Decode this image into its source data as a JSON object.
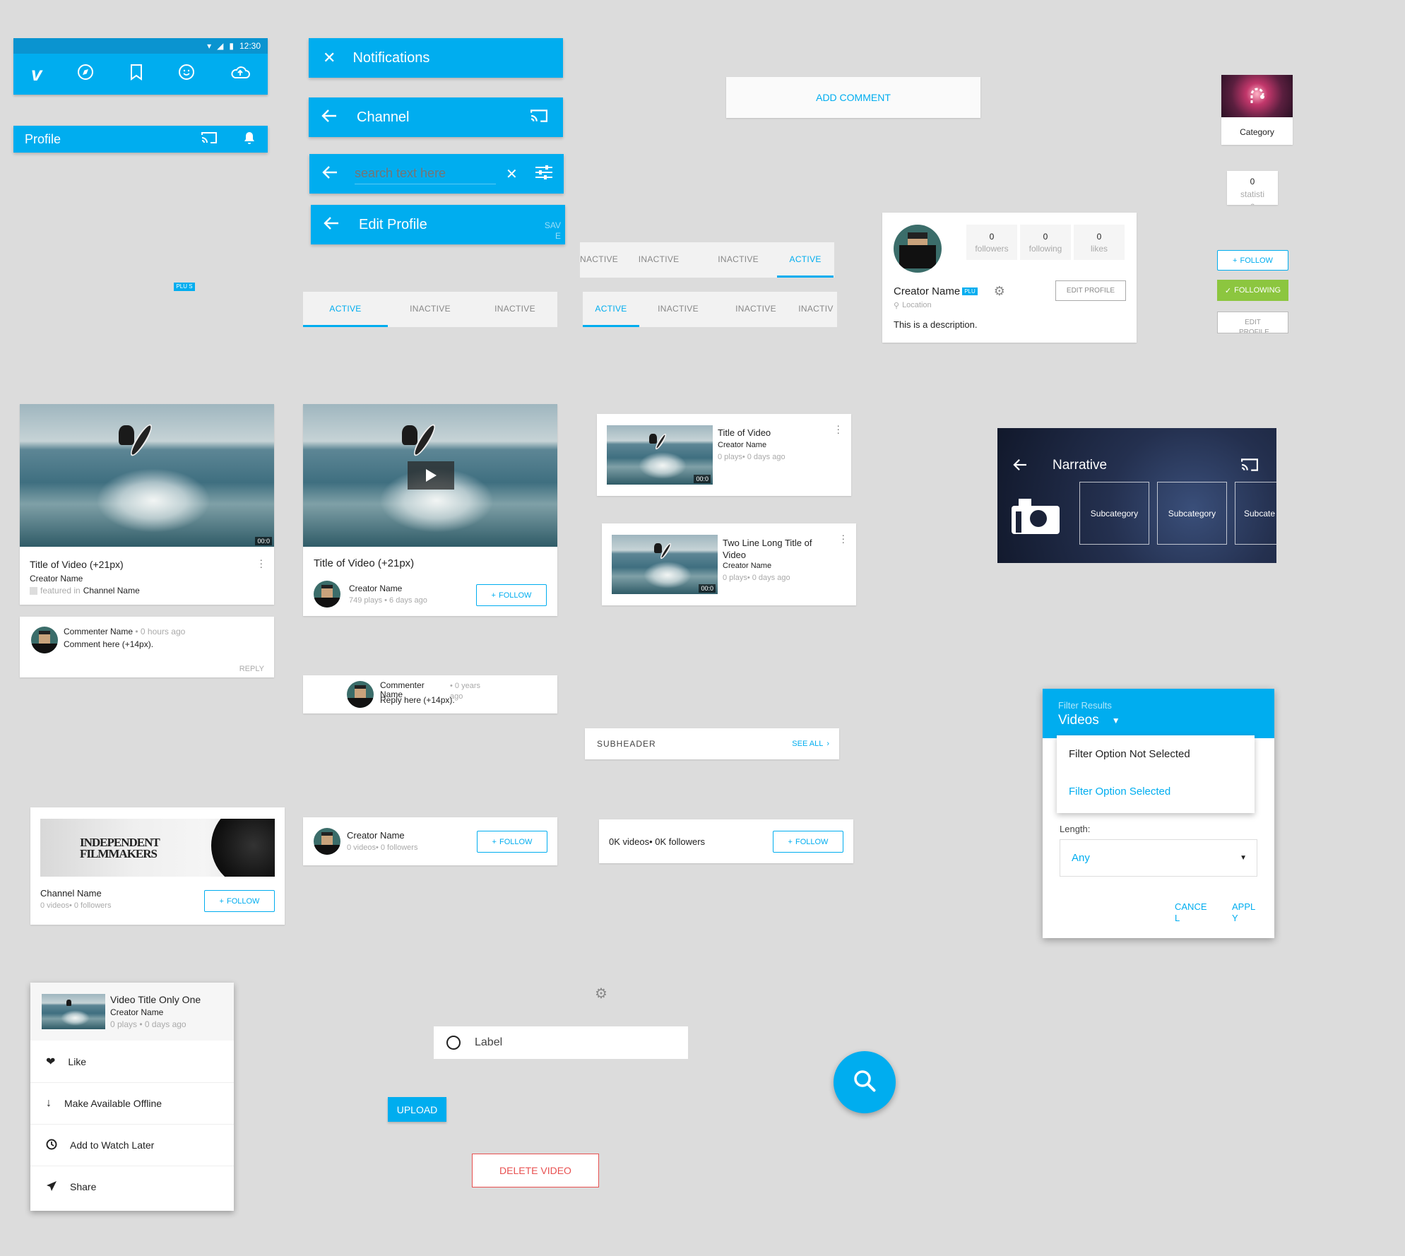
{
  "status_bar": {
    "time": "12:30"
  },
  "top_nav": {
    "icons": [
      "vimeo-logo-icon",
      "compass-icon",
      "bookmark-icon",
      "smiley-icon",
      "cloud-upload-icon"
    ]
  },
  "profile_bar": {
    "title": "Profile"
  },
  "appbars": {
    "notifications": "Notifications",
    "channel": "Channel",
    "search_placeholder": "search text here",
    "edit_profile": "Edit Profile",
    "save": "SAV E"
  },
  "plus_badge": "PLU S",
  "tabs_a": [
    "ACTIVE",
    "INACTIVE",
    "INACTIVE"
  ],
  "tabs_b": [
    "ACTIVE",
    "INACTIVE",
    "INACTIVE",
    "INACTIV"
  ],
  "tabs_c": [
    "NACTIVE",
    "INACTIVE",
    "INACTIVE",
    "ACTIVE"
  ],
  "add_comment": "ADD COMMENT",
  "category_tile": {
    "label": "Category"
  },
  "stat_tile": {
    "value": "0",
    "label": "statisti c"
  },
  "profile_card": {
    "stats": [
      {
        "value": "0",
        "label": "followers"
      },
      {
        "value": "0",
        "label": "following"
      },
      {
        "value": "0",
        "label": "likes"
      }
    ],
    "name": "Creator Name",
    "badge": "PLU",
    "location": "Location",
    "description": "This is a description.",
    "edit_button": "EDIT PROFILE"
  },
  "follow_buttons": {
    "follow": "FOLLOW",
    "following": "FOLLOWING",
    "edit_profile": "EDIT PROFILE"
  },
  "video_card_1": {
    "title": "Title of Video (+21px)",
    "creator": "Creator Name",
    "featured_prefix": "featured in",
    "channel": "Channel Name",
    "duration": "00:0"
  },
  "video_card_2": {
    "title": "Title of Video (+21px)",
    "creator": "Creator Name",
    "meta": "749 plays • 6 days ago",
    "follow": "FOLLOW"
  },
  "list_video_1": {
    "title": "Title of Video",
    "creator": "Creator Name",
    "meta": "0 plays• 0 days ago",
    "duration": "00:0"
  },
  "list_video_2": {
    "title": "Two Line Long Title of Video",
    "creator": "Creator Name",
    "meta": "0 plays• 0 days ago",
    "duration": "00:0"
  },
  "comment": {
    "name": "Commenter Name",
    "time": "• 0 hours ago",
    "text": "Comment here (+14px).",
    "reply": "REPLY"
  },
  "reply": {
    "name": "Commenter Name",
    "time": "• 0 years ago",
    "text": "Reply here (+14px)."
  },
  "subheader": {
    "label": "SUBHEADER",
    "see_all": "SEE ALL"
  },
  "category_header": {
    "title": "Narrative",
    "subcategories": [
      "Subcategory",
      "Subcategory",
      "Subcate"
    ]
  },
  "channel_card": {
    "banner_text": "INDEPENDENT FILMMAKERS",
    "name": "Channel Name",
    "meta": "0 videos• 0 followers",
    "follow": "FOLLOW"
  },
  "creator_row": {
    "name": "Creator Name",
    "meta": "0 videos• 0 followers",
    "follow": "FOLLOW"
  },
  "stats_row": {
    "text": "0K videos• 0K followers",
    "follow": "FOLLOW"
  },
  "filter_dialog": {
    "header_label": "Filter Results",
    "header_value": "Videos",
    "options": [
      {
        "label": "Filter Option Not Selected",
        "selected": false
      },
      {
        "label": "Filter Option Selected",
        "selected": true
      }
    ],
    "length_label": "Length:",
    "length_value": "Any",
    "cancel": "CANCE L",
    "apply": "APPL Y"
  },
  "bottom_sheet": {
    "video_title": "Video Title Only One",
    "creator": "Creator Name",
    "meta": "0 plays • 0 days ago",
    "items": [
      {
        "label": "Like",
        "icon": "heart-icon"
      },
      {
        "label": "Make Available Offline",
        "icon": "download-icon"
      },
      {
        "label": "Add to Watch Later",
        "icon": "clock-icon"
      },
      {
        "label": "Share",
        "icon": "send-icon"
      }
    ]
  },
  "radio_row": {
    "label": "Label"
  },
  "upload_button": "UPLOAD",
  "delete_button": "DELETE VIDEO",
  "colors": {
    "accent": "#00adef",
    "follow_green": "#8cc63f",
    "delete_red": "#e85050"
  }
}
